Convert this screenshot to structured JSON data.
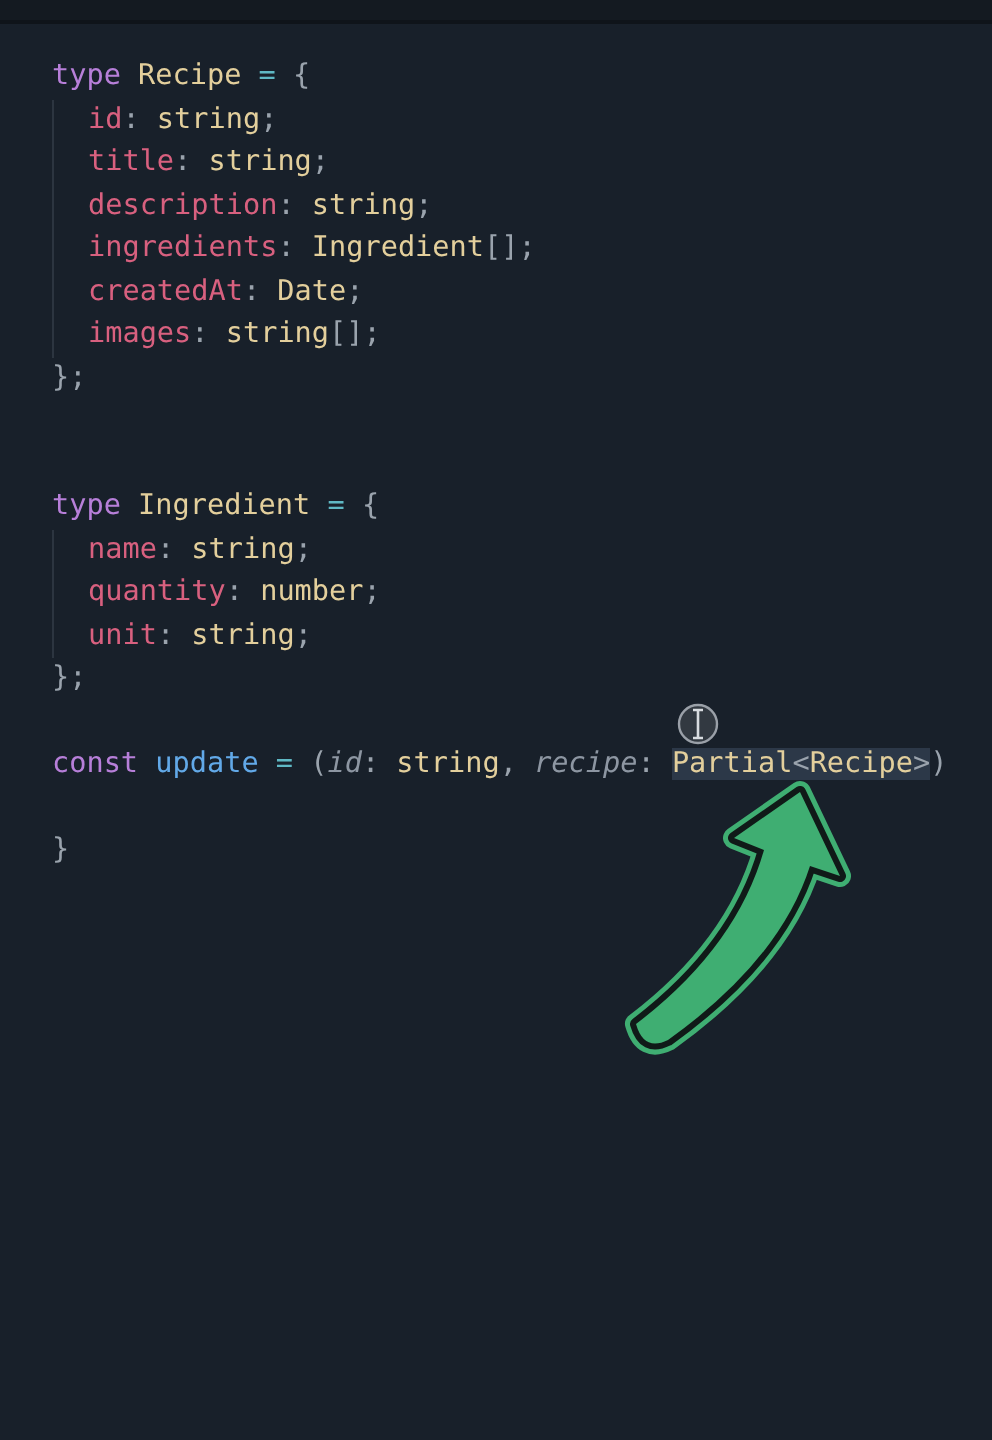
{
  "code": {
    "lines": [
      {
        "indented": false,
        "tokens": [
          {
            "kind": "keyword",
            "text": "type"
          },
          {
            "kind": "type",
            "text": " Recipe"
          },
          {
            "kind": "operator",
            "text": " ="
          },
          {
            "kind": "punct",
            "text": " {"
          }
        ]
      },
      {
        "indented": true,
        "tokens": [
          {
            "kind": "prop",
            "text": "id"
          },
          {
            "kind": "punct",
            "text": ":"
          },
          {
            "kind": "type",
            "text": " string"
          },
          {
            "kind": "punct",
            "text": ";"
          }
        ]
      },
      {
        "indented": true,
        "tokens": [
          {
            "kind": "prop",
            "text": "title"
          },
          {
            "kind": "punct",
            "text": ":"
          },
          {
            "kind": "type",
            "text": " string"
          },
          {
            "kind": "punct",
            "text": ";"
          }
        ]
      },
      {
        "indented": true,
        "tokens": [
          {
            "kind": "prop",
            "text": "description"
          },
          {
            "kind": "punct",
            "text": ":"
          },
          {
            "kind": "type",
            "text": " string"
          },
          {
            "kind": "punct",
            "text": ";"
          }
        ]
      },
      {
        "indented": true,
        "tokens": [
          {
            "kind": "prop",
            "text": "ingredients"
          },
          {
            "kind": "punct",
            "text": ":"
          },
          {
            "kind": "type",
            "text": " Ingredient"
          },
          {
            "kind": "punct",
            "text": "[];"
          }
        ]
      },
      {
        "indented": true,
        "tokens": [
          {
            "kind": "prop",
            "text": "createdAt"
          },
          {
            "kind": "punct",
            "text": ":"
          },
          {
            "kind": "type",
            "text": " Date"
          },
          {
            "kind": "punct",
            "text": ";"
          }
        ]
      },
      {
        "indented": true,
        "tokens": [
          {
            "kind": "prop",
            "text": "images"
          },
          {
            "kind": "punct",
            "text": ":"
          },
          {
            "kind": "type",
            "text": " string"
          },
          {
            "kind": "punct",
            "text": "[];"
          }
        ]
      },
      {
        "indented": false,
        "tokens": [
          {
            "kind": "punct",
            "text": "};"
          }
        ]
      },
      {
        "kind": "blank"
      },
      {
        "kind": "blank"
      },
      {
        "indented": false,
        "tokens": [
          {
            "kind": "keyword",
            "text": "type"
          },
          {
            "kind": "type",
            "text": " Ingredient"
          },
          {
            "kind": "operator",
            "text": " ="
          },
          {
            "kind": "punct",
            "text": " {"
          }
        ]
      },
      {
        "indented": true,
        "tokens": [
          {
            "kind": "prop",
            "text": "name"
          },
          {
            "kind": "punct",
            "text": ":"
          },
          {
            "kind": "type",
            "text": " string"
          },
          {
            "kind": "punct",
            "text": ";"
          }
        ]
      },
      {
        "indented": true,
        "tokens": [
          {
            "kind": "prop",
            "text": "quantity"
          },
          {
            "kind": "punct",
            "text": ":"
          },
          {
            "kind": "type",
            "text": " number"
          },
          {
            "kind": "punct",
            "text": ";"
          }
        ]
      },
      {
        "indented": true,
        "tokens": [
          {
            "kind": "prop",
            "text": "unit"
          },
          {
            "kind": "punct",
            "text": ":"
          },
          {
            "kind": "type",
            "text": " string"
          },
          {
            "kind": "punct",
            "text": ";"
          }
        ]
      },
      {
        "indented": false,
        "tokens": [
          {
            "kind": "punct",
            "text": "};"
          }
        ]
      },
      {
        "kind": "blank"
      },
      {
        "indented": false,
        "tokens": [
          {
            "kind": "keyword",
            "text": "const"
          },
          {
            "kind": "function",
            "text": " update"
          },
          {
            "kind": "operator",
            "text": " ="
          },
          {
            "kind": "punct",
            "text": " ("
          },
          {
            "kind": "param",
            "text": "id"
          },
          {
            "kind": "punct",
            "text": ":"
          },
          {
            "kind": "type",
            "text": " string"
          },
          {
            "kind": "punct",
            "text": ", "
          },
          {
            "kind": "param",
            "text": "recipe"
          },
          {
            "kind": "punct",
            "text": ": "
          },
          {
            "kind": "type",
            "text": "Partial",
            "selected": true
          },
          {
            "kind": "punct",
            "text": "<",
            "selected": true
          },
          {
            "kind": "type",
            "text": "Recipe",
            "selected": true
          },
          {
            "kind": "punct",
            "text": ">",
            "selected": true
          },
          {
            "kind": "punct",
            "text": ")"
          }
        ]
      },
      {
        "kind": "blank"
      },
      {
        "indented": false,
        "tokens": [
          {
            "kind": "punct",
            "text": "}"
          }
        ]
      }
    ]
  }
}
